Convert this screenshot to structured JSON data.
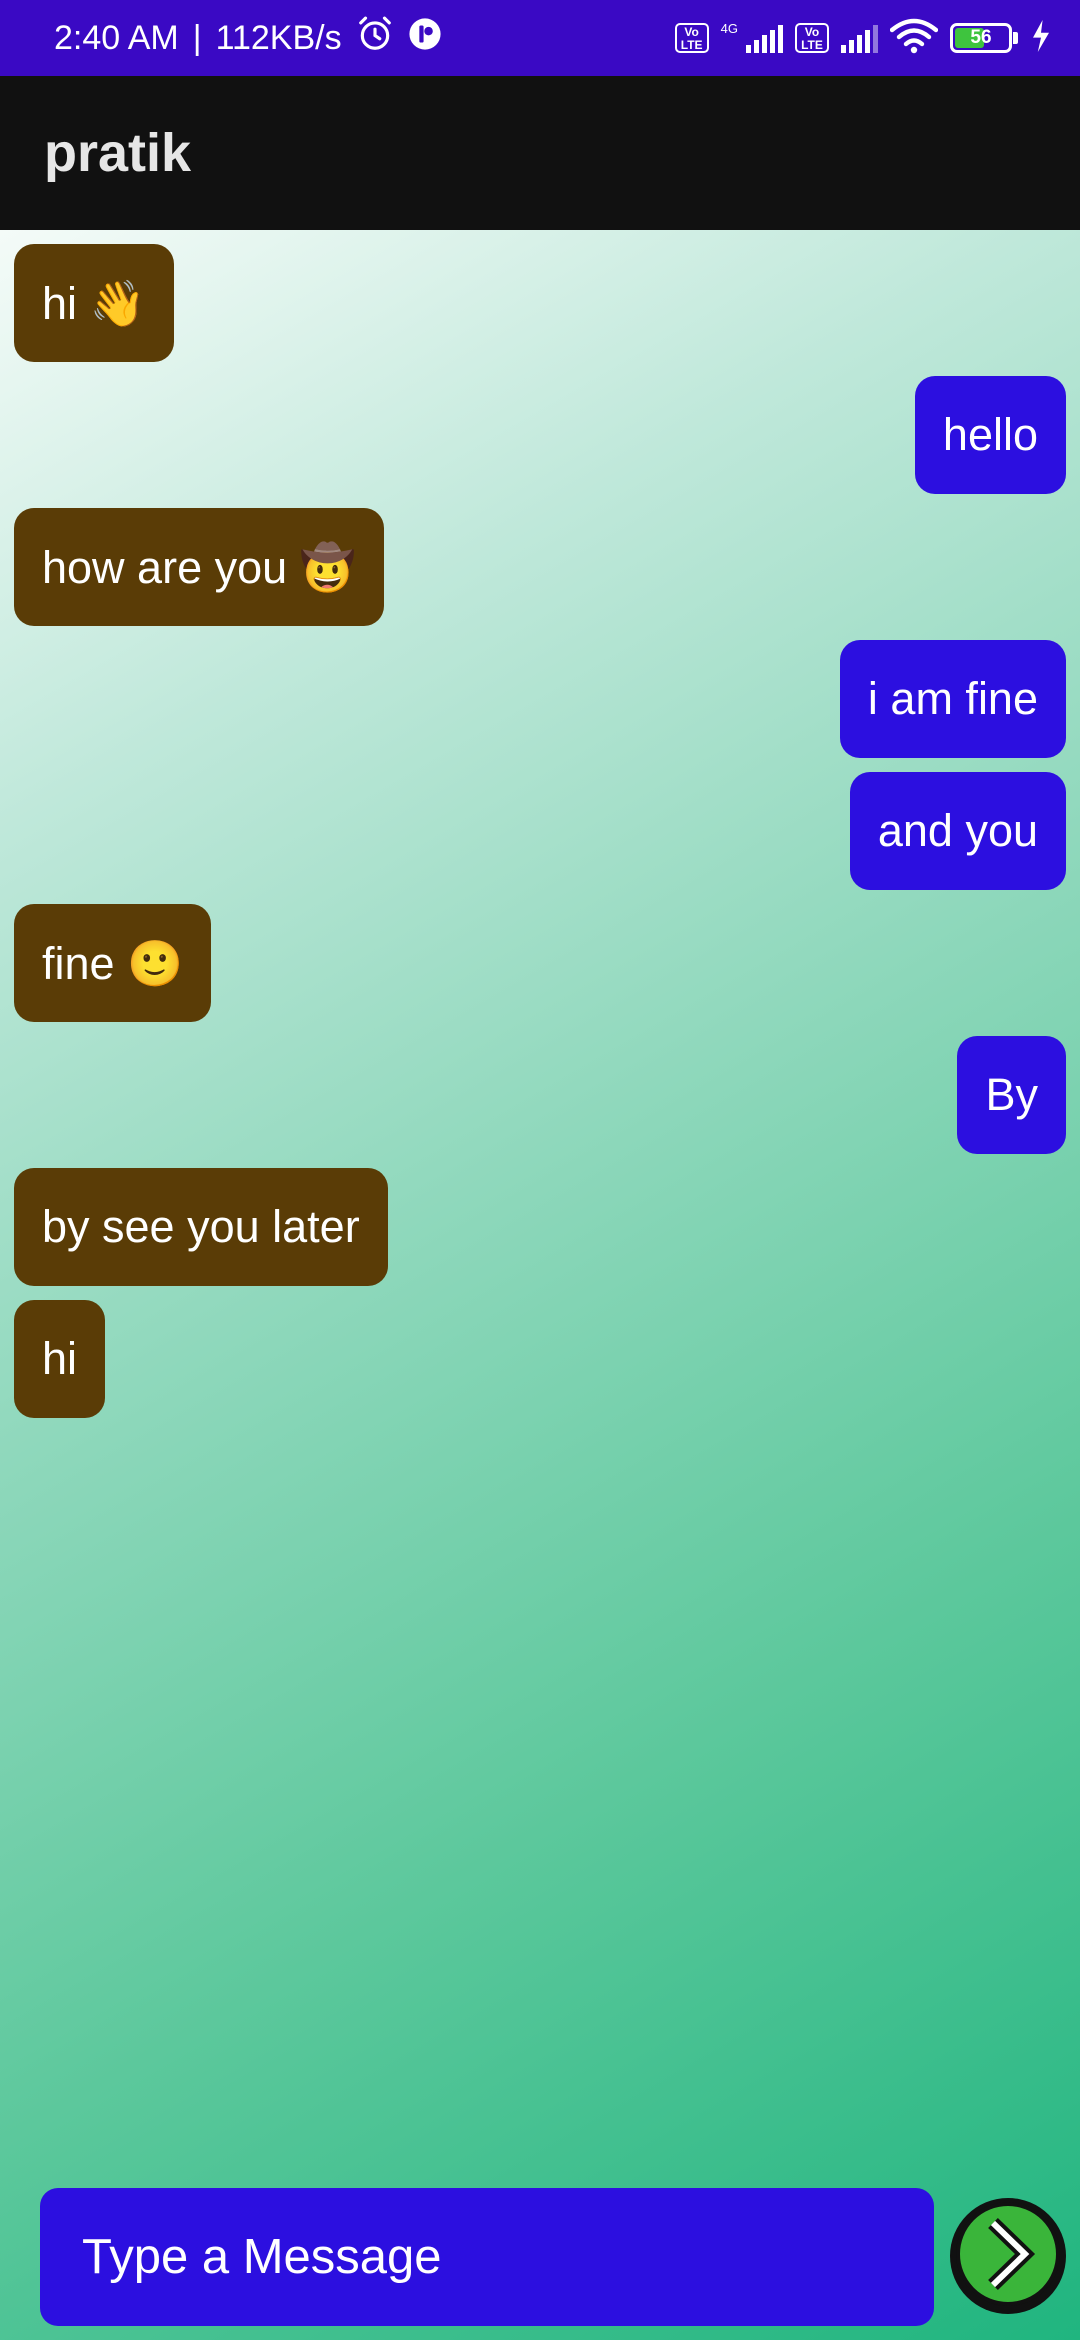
{
  "status_bar": {
    "time": "2:40 AM",
    "separator": "|",
    "speed": "112KB/s",
    "icons": [
      "alarm-icon",
      "app-notification-icon",
      "volte-icon",
      "signal-icon",
      "wifi-icon",
      "battery-icon",
      "charging-icon"
    ],
    "network": "4G",
    "volte_label": "Vo LTE",
    "battery": "56",
    "battery_level": 0.56
  },
  "app_bar": {
    "title": "pratik"
  },
  "messages": [
    {
      "direction": "in",
      "text": "hi 👋"
    },
    {
      "direction": "out",
      "text": "hello"
    },
    {
      "direction": "in",
      "text": "how are you 🤠"
    },
    {
      "direction": "out",
      "text": "i am fine"
    },
    {
      "direction": "out",
      "text": "and you"
    },
    {
      "direction": "in",
      "text": "fine 🙂"
    },
    {
      "direction": "out",
      "text": "By"
    },
    {
      "direction": "in",
      "text": "by see you later"
    },
    {
      "direction": "in",
      "text": "hi"
    }
  ],
  "composer": {
    "placeholder": "Type a Message"
  },
  "send_button": {
    "icon": "chevron-right-icon"
  },
  "colors": {
    "status_bar": "#3a09c4",
    "app_bar": "#111111",
    "incoming_bubble": "#5a3c06",
    "outgoing_bubble": "#2c0fe0",
    "send_button_fill": "#3ab53a"
  }
}
